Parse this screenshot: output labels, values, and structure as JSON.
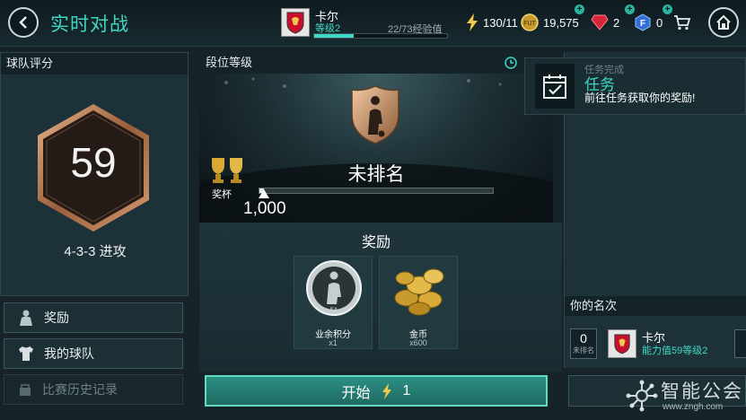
{
  "header": {
    "title": "实时对战",
    "player_name": "卡尔",
    "player_level": "等级2",
    "xp_text": "22/73经验值",
    "xp_progress": 0.3
  },
  "resources": {
    "energy": "130/11",
    "coins": "19,575",
    "gems": "2",
    "points": "0"
  },
  "left_panel": {
    "title": "球队评分",
    "rating": "59",
    "formation": "4-3-3 进攻",
    "buttons": {
      "rewards": "奖励",
      "my_team": "我的球队",
      "history": "比赛历史记录"
    }
  },
  "center": {
    "title": "段位等级",
    "rank": "未排名",
    "trophy_label": "奖杯",
    "trophy_count": "1,000",
    "trophy_progress": 0.02,
    "rewards_title": "奖励",
    "rewards": [
      {
        "name": "业余积分",
        "qty": "x1"
      },
      {
        "name": "金币",
        "qty": "x600"
      }
    ],
    "start_label": "开始",
    "start_cost": "1"
  },
  "task": {
    "done": "任务完成",
    "title": "任务",
    "desc": "前往任务获取你的奖励!"
  },
  "ranking": {
    "title": "你的名次",
    "position": "0",
    "position_label": "未排名",
    "name": "卡尔",
    "stats": "能力值59等级2"
  },
  "watermark": {
    "text": "智能公会",
    "url": "www.zngh.com"
  },
  "colors": {
    "accent": "#3fd8c4",
    "background": "#16242a",
    "start_button": "#2b8f82"
  }
}
